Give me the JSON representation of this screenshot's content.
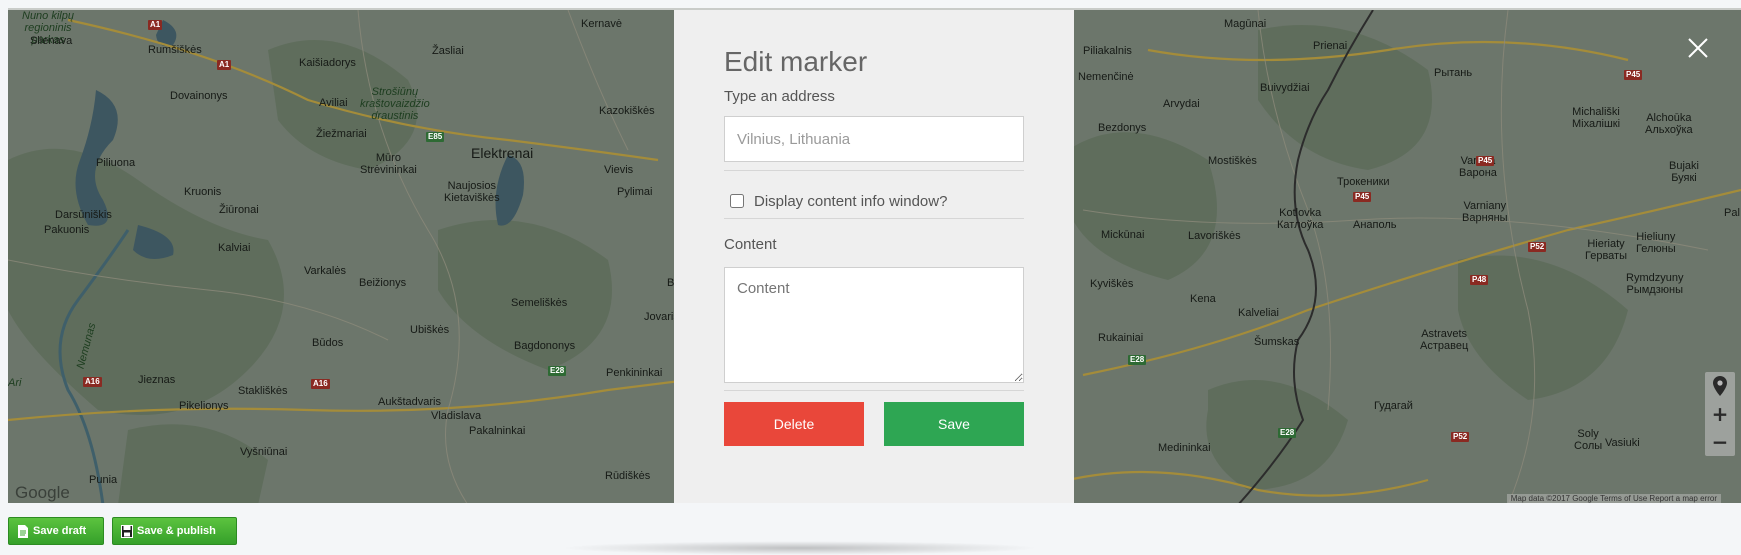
{
  "map": {
    "labels": [
      {
        "text": "Kernavė"
      },
      {
        "text": "Slienava"
      },
      {
        "text": "Rumšiškės"
      },
      {
        "text": "Žasliai"
      },
      {
        "text": "Kaišiadorys"
      },
      {
        "text": "Dovainonys"
      },
      {
        "text": "Aviliai"
      },
      {
        "text": "Strošiūnų\nkraštovaizdžio\ndraustinis"
      },
      {
        "text": "Kazokiškės"
      },
      {
        "text": "Žiežmariai"
      },
      {
        "text": "Elektrenai"
      },
      {
        "text": "Piliuona"
      },
      {
        "text": "Mūro\nStrėvininkai"
      },
      {
        "text": "Vievis"
      },
      {
        "text": "Naujosios\nKietaviškės"
      },
      {
        "text": "Pylimai"
      },
      {
        "text": "Kruonis"
      },
      {
        "text": "Žiūronai"
      },
      {
        "text": "Darsūniškis"
      },
      {
        "text": "Pakuonis"
      },
      {
        "text": "Kalviai"
      },
      {
        "text": "Varkalės"
      },
      {
        "text": "Beižionys"
      },
      {
        "text": "Semeliškės"
      },
      {
        "text": "Jovariški"
      },
      {
        "text": "Ubiškės"
      },
      {
        "text": "Bagdononys"
      },
      {
        "text": "Būdos"
      },
      {
        "text": "Penkininkai"
      },
      {
        "text": "Jieznas"
      },
      {
        "text": "Stakliškės"
      },
      {
        "text": "Pikelionys"
      },
      {
        "text": "Aukštadvaris"
      },
      {
        "text": "Vladislava"
      },
      {
        "text": "Pakalninkai"
      },
      {
        "text": "Vyšniūnai"
      },
      {
        "text": "Punia"
      },
      {
        "text": "Rūdiškės"
      },
      {
        "text": "Nemunas"
      },
      {
        "text": "Br"
      },
      {
        "text": "Magūnai"
      },
      {
        "text": "Prienai"
      },
      {
        "text": "Рытань"
      },
      {
        "text": "Piliakalnis"
      },
      {
        "text": "Nemenčinė"
      },
      {
        "text": "Buivydžiai"
      },
      {
        "text": "Michališki\nМіхалішкі"
      },
      {
        "text": "Alchoūka\nАльхоўка"
      },
      {
        "text": "Arvydai"
      },
      {
        "text": "Bezdonys"
      },
      {
        "text": "Mostiškės"
      },
      {
        "text": "Varona\nВарона"
      },
      {
        "text": "Bujaki\nБуякі"
      },
      {
        "text": "Трокеники"
      },
      {
        "text": "Varniany\nВарняны"
      },
      {
        "text": "Kotlovka\nКатлоўка"
      },
      {
        "text": "Анаполь"
      },
      {
        "text": "Mickūnai"
      },
      {
        "text": "Lavoriškės"
      },
      {
        "text": "Hieriaty\nГерваты"
      },
      {
        "text": "Hieliuny\nГелюны"
      },
      {
        "text": "Kyviškės"
      },
      {
        "text": "Rymdzyuny\nРымдзюны"
      },
      {
        "text": "Kena"
      },
      {
        "text": "Kalveliai"
      },
      {
        "text": "Rukainiai"
      },
      {
        "text": "Šumskas"
      },
      {
        "text": "Astravets\nАстравец"
      },
      {
        "text": "Гудагай"
      },
      {
        "text": "Medininkai"
      },
      {
        "text": "Soly\nСолы"
      },
      {
        "text": "Vasiuki"
      },
      {
        "text": "Pal"
      },
      {
        "text": "Ari"
      },
      {
        "text": "Nuno kilpų\nregioninis\nparkas"
      },
      {
        "text": "regioninis\nparkas"
      }
    ],
    "shields": [
      "A1",
      "A1",
      "E85",
      "A16",
      "A16",
      "E28",
      "P45",
      "P45",
      "P45",
      "P52",
      "P48",
      "P52",
      "E28",
      "E28"
    ],
    "google_logo": "Google",
    "footer_text": "Map data ©2017 Google   Terms of Use   Report a map error",
    "controls": {
      "pin": "street-view-pin-icon",
      "zoom_in": "+",
      "zoom_out": "−"
    }
  },
  "modal": {
    "title": "Edit marker",
    "address_label": "Type an address",
    "address_placeholder": "Vilnius, Lithuania",
    "checkbox_label": "Display content info window?",
    "checkbox_checked": false,
    "content_label": "Content",
    "content_placeholder": "Content",
    "delete_label": "Delete",
    "save_label": "Save",
    "colors": {
      "delete": "#e9473a",
      "save": "#2ea653",
      "panel": "#efefef"
    }
  },
  "close_icon": "close-icon",
  "bottom_bar": {
    "save_draft_label": "Save draft",
    "save_publish_label": "Save & publish",
    "button_color": "#3daa2e"
  }
}
